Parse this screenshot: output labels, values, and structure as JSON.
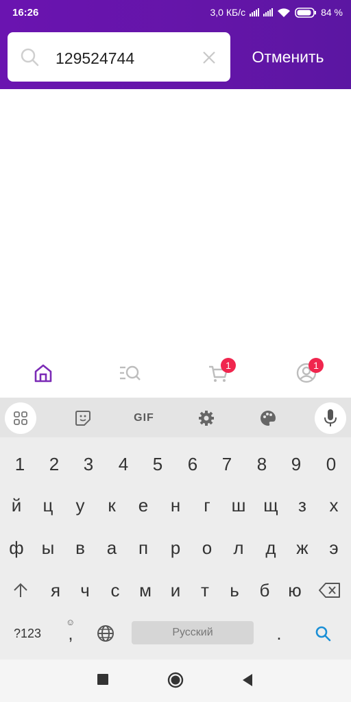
{
  "status_bar": {
    "time": "16:26",
    "net_speed": "3,0 КБ/с",
    "battery": "84 %"
  },
  "search": {
    "value": "129524744",
    "cancel_label": "Отменить"
  },
  "bottom_nav": {
    "cart_badge": "1",
    "profile_badge": "1",
    "active_color": "#7b2bb6",
    "icon_color": "#bdbdbd"
  },
  "keyboard": {
    "toolbar": {
      "gif_label": "GIF"
    },
    "row_numbers": [
      "1",
      "2",
      "3",
      "4",
      "5",
      "6",
      "7",
      "8",
      "9",
      "0"
    ],
    "row1": [
      "й",
      "ц",
      "у",
      "к",
      "е",
      "н",
      "г",
      "ш",
      "щ",
      "з",
      "х"
    ],
    "row2": [
      "ф",
      "ы",
      "в",
      "а",
      "п",
      "р",
      "о",
      "л",
      "д",
      "ж",
      "э"
    ],
    "row3": [
      "я",
      "ч",
      "с",
      "м",
      "и",
      "т",
      "ь",
      "б",
      "ю"
    ],
    "symbols_label": "?123",
    "comma": ",",
    "space_label": "Русский",
    "period": "."
  },
  "colors": {
    "header": "#6415a8",
    "badge": "#f0264e",
    "search_key": "#1a8fd6"
  }
}
